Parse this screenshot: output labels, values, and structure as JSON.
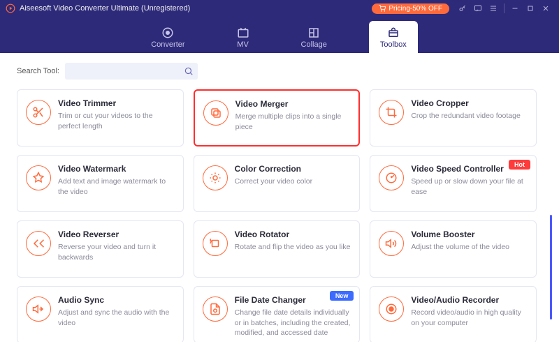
{
  "titlebar": {
    "title": "Aiseesoft Video Converter Ultimate (Unregistered)",
    "pricing": "Pricing-50% OFF"
  },
  "nav": {
    "items": [
      {
        "label": "Converter"
      },
      {
        "label": "MV"
      },
      {
        "label": "Collage"
      },
      {
        "label": "Toolbox"
      }
    ]
  },
  "search": {
    "label": "Search Tool:",
    "placeholder": ""
  },
  "tools": [
    {
      "title": "Video Trimmer",
      "desc": "Trim or cut your videos to the perfect length",
      "badge": ""
    },
    {
      "title": "Video Merger",
      "desc": "Merge multiple clips into a single piece",
      "badge": ""
    },
    {
      "title": "Video Cropper",
      "desc": "Crop the redundant video footage",
      "badge": ""
    },
    {
      "title": "Video Watermark",
      "desc": "Add text and image watermark to the video",
      "badge": ""
    },
    {
      "title": "Color Correction",
      "desc": "Correct your video color",
      "badge": ""
    },
    {
      "title": "Video Speed Controller",
      "desc": "Speed up or slow down your file at ease",
      "badge": "Hot"
    },
    {
      "title": "Video Reverser",
      "desc": "Reverse your video and turn it backwards",
      "badge": ""
    },
    {
      "title": "Video Rotator",
      "desc": "Rotate and flip the video as you like",
      "badge": ""
    },
    {
      "title": "Volume Booster",
      "desc": "Adjust the volume of the video",
      "badge": ""
    },
    {
      "title": "Audio Sync",
      "desc": "Adjust and sync the audio with the video",
      "badge": ""
    },
    {
      "title": "File Date Changer",
      "desc": "Change file date details individually or in batches, including the created, modified, and accessed date",
      "badge": "New"
    },
    {
      "title": "Video/Audio Recorder",
      "desc": "Record video/audio in high quality on your computer",
      "badge": ""
    }
  ]
}
